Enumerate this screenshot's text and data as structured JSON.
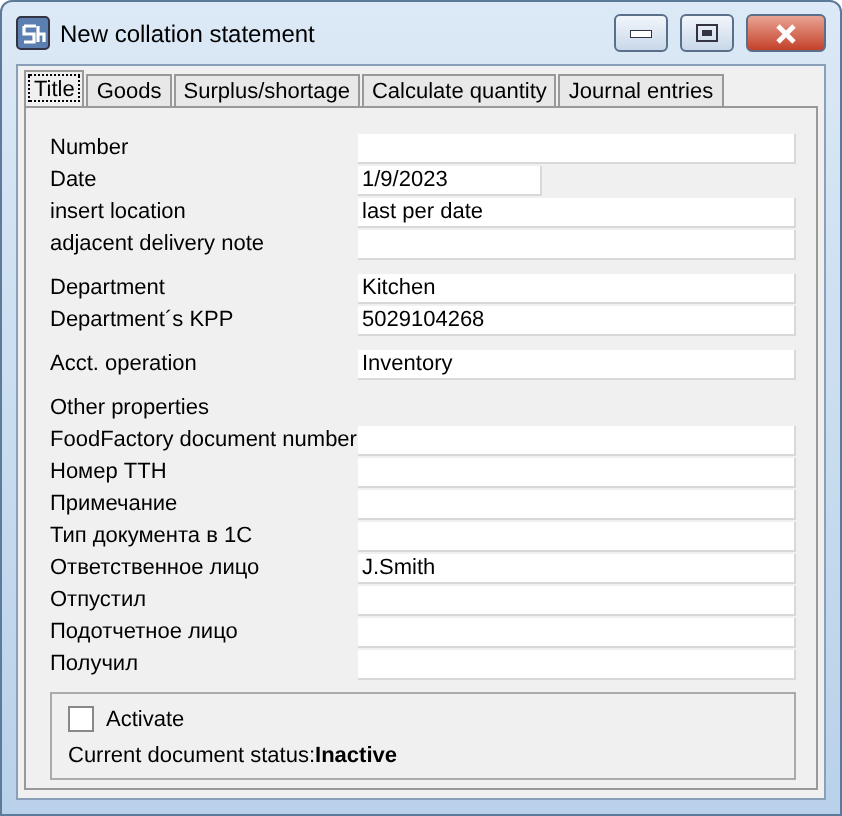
{
  "window": {
    "title": "New collation statement"
  },
  "tabs": [
    {
      "label": "Title",
      "selected": true
    },
    {
      "label": "Goods",
      "selected": false
    },
    {
      "label": "Surplus/shortage",
      "selected": false
    },
    {
      "label": "Calculate quantity",
      "selected": false
    },
    {
      "label": "Journal entries",
      "selected": false
    }
  ],
  "sections": [
    {
      "fields": [
        {
          "label": "Number"
        },
        {
          "label": "Date",
          "value": "1/9/2023",
          "kind": "short"
        },
        {
          "label": "insert location",
          "value": "last per date"
        },
        {
          "label": "adjacent delivery note"
        }
      ]
    },
    {
      "fields": [
        {
          "label": "Department",
          "value": "Kitchen"
        },
        {
          "label": "Department´s KPP",
          "value": "5029104268"
        }
      ]
    },
    {
      "fields": [
        {
          "label": "Acct. operation",
          "value": "Inventory"
        }
      ]
    },
    {
      "heading": "Other properties",
      "fields": [
        {
          "label": "FoodFactory document number"
        },
        {
          "label": "Номер ТТН"
        },
        {
          "label": "Примечание"
        },
        {
          "label": "Тип документа в 1С"
        },
        {
          "label": "Ответственное лицо",
          "value": "J.Smith"
        },
        {
          "label": "Отпустил"
        },
        {
          "label": "Подотчетное лицо"
        },
        {
          "label": "Получил"
        }
      ]
    }
  ],
  "activate": {
    "label": "Activate",
    "checked": false
  },
  "status": "Current document status:**Inactive**"
}
